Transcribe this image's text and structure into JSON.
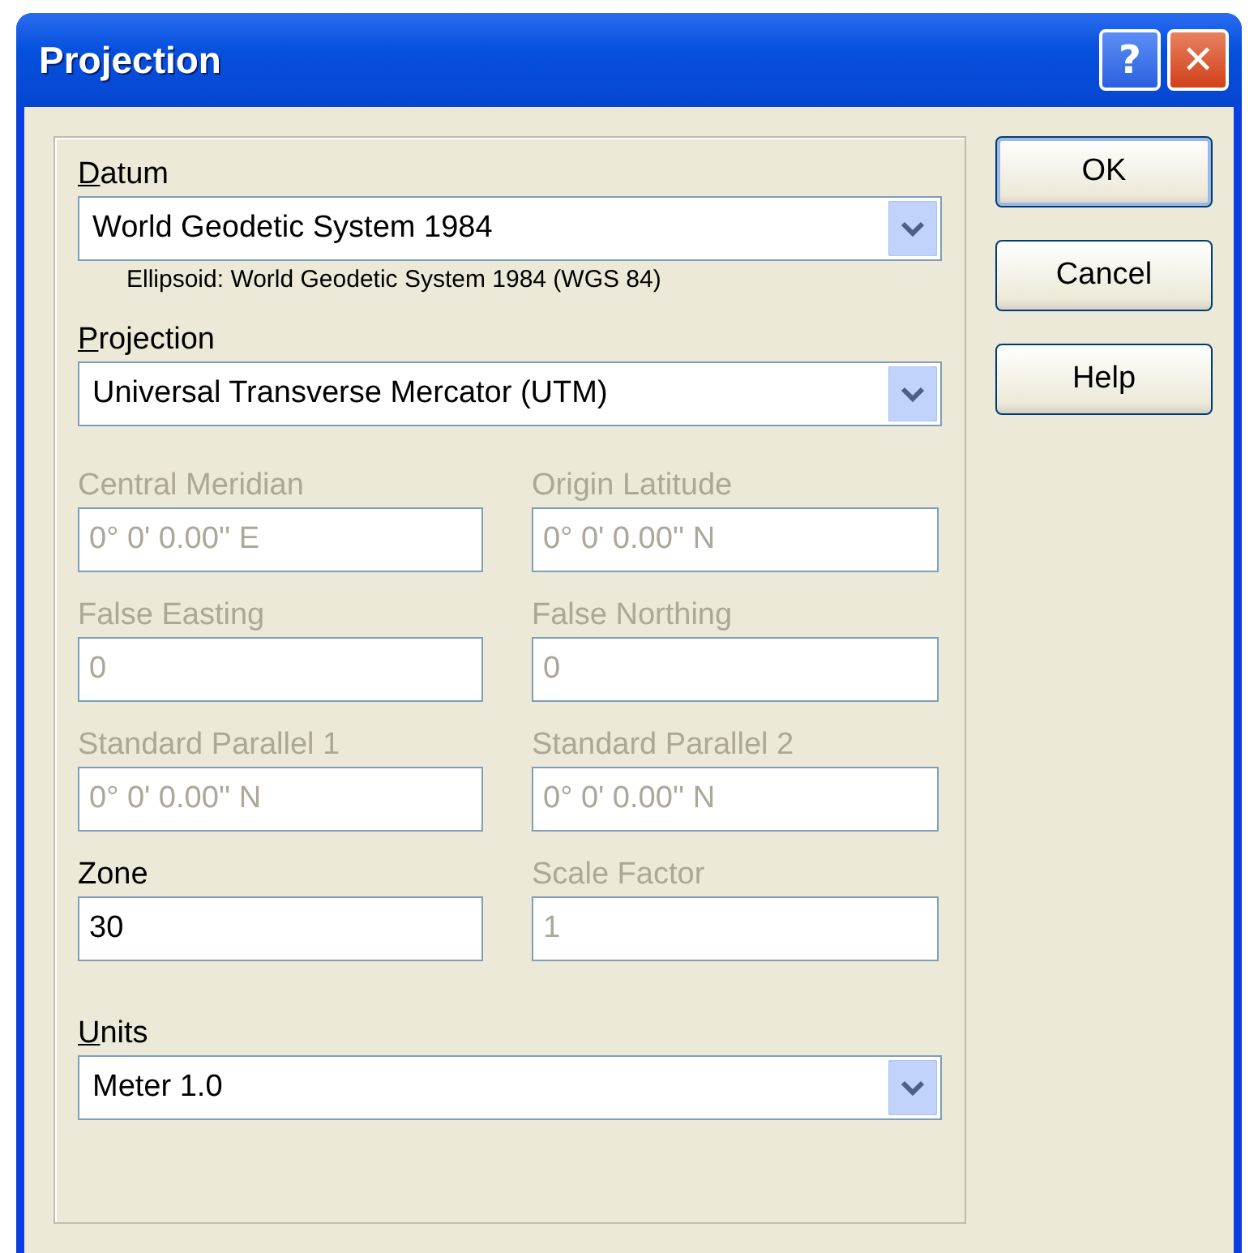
{
  "window": {
    "title": "Projection",
    "title_buttons": [
      "?",
      "✕"
    ]
  },
  "datum": {
    "label": "Datum",
    "mnemonic": true,
    "value": "World Geodetic System 1984",
    "note": "Ellipsoid: World Geodetic System 1984 (WGS 84)"
  },
  "projection": {
    "label": "Projection",
    "mnemonic": true,
    "value": "Universal Transverse Mercator (UTM)"
  },
  "parameters": [
    {
      "label": "Central Meridian",
      "value": "0° 0' 0.00'' E",
      "disabled": true
    },
    {
      "label": "Origin Latitude",
      "value": "0° 0' 0.00'' N",
      "disabled": true
    },
    {
      "label": "False Easting",
      "value": "0",
      "disabled": true
    },
    {
      "label": "False Northing",
      "value": "0",
      "disabled": true
    },
    {
      "label": "Standard Parallel 1",
      "value": "0° 0' 0.00'' N",
      "disabled": true
    },
    {
      "label": "Standard Parallel 2",
      "value": "0° 0' 0.00'' N",
      "disabled": true
    },
    {
      "label": "Zone",
      "value": "30",
      "disabled": false
    },
    {
      "label": "Scale Factor",
      "value": "1",
      "disabled": true
    }
  ],
  "units": {
    "label": "Units",
    "mnemonic": true,
    "value": "Meter 1.0"
  },
  "buttons": [
    "OK",
    "Cancel",
    "Help"
  ]
}
